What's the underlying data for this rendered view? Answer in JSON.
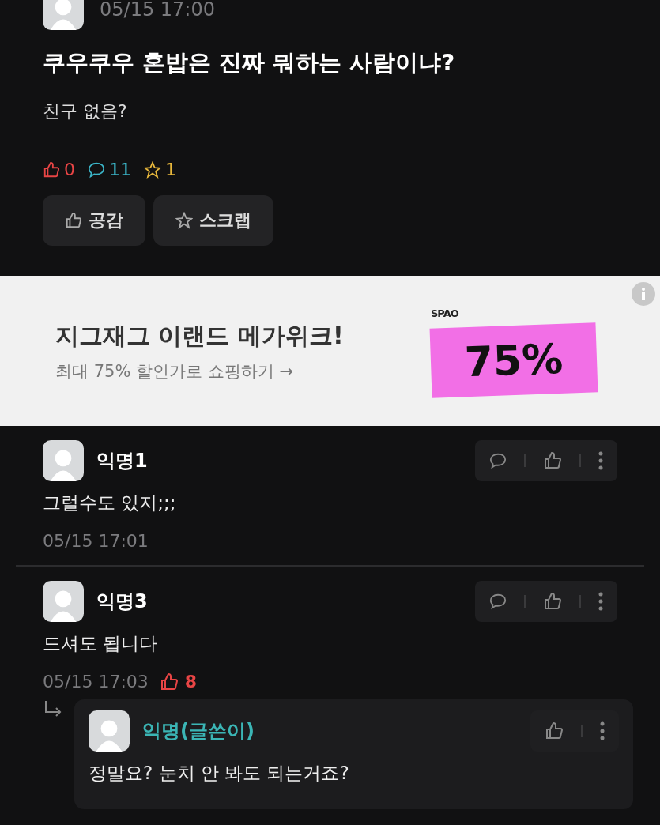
{
  "post": {
    "time": "05/15 17:00",
    "title": "쿠우쿠우 혼밥은 진짜 뭐하는 사람이냐?",
    "body": "친구 없음?",
    "stats": [
      {
        "kind": "like",
        "count": "0"
      },
      {
        "kind": "comment",
        "count": "11"
      },
      {
        "kind": "scrap",
        "count": "1"
      }
    ],
    "buttons": [
      {
        "kind": "like",
        "label": "공감"
      },
      {
        "kind": "scrap",
        "label": "스크랩"
      }
    ]
  },
  "ad": {
    "title": "지그재그 이랜드 메가위크!",
    "subtitle": "최대 75% 할인가로 쇼핑하기 →",
    "brand": "SPAO",
    "discount": "75%"
  },
  "comments": [
    {
      "author": "익명1",
      "is_writer": false,
      "text": "그럴수도 있지;;;",
      "time": "05/15 17:01",
      "actions": [
        {
          "kind": "comment"
        },
        {
          "kind": "like"
        },
        {
          "kind": "more"
        }
      ]
    },
    {
      "author": "익명3",
      "is_writer": false,
      "text": "드셔도 됩니다",
      "time": "05/15 17:03",
      "likes": "8",
      "actions": [
        {
          "kind": "comment"
        },
        {
          "kind": "like"
        },
        {
          "kind": "more"
        }
      ],
      "replies": [
        {
          "author": "익명(글쓴이)",
          "is_writer": true,
          "text": "정말요? 눈치 안 봐도 되는거죠?",
          "actions": [
            {
              "kind": "like"
            },
            {
              "kind": "more"
            }
          ]
        }
      ]
    }
  ]
}
